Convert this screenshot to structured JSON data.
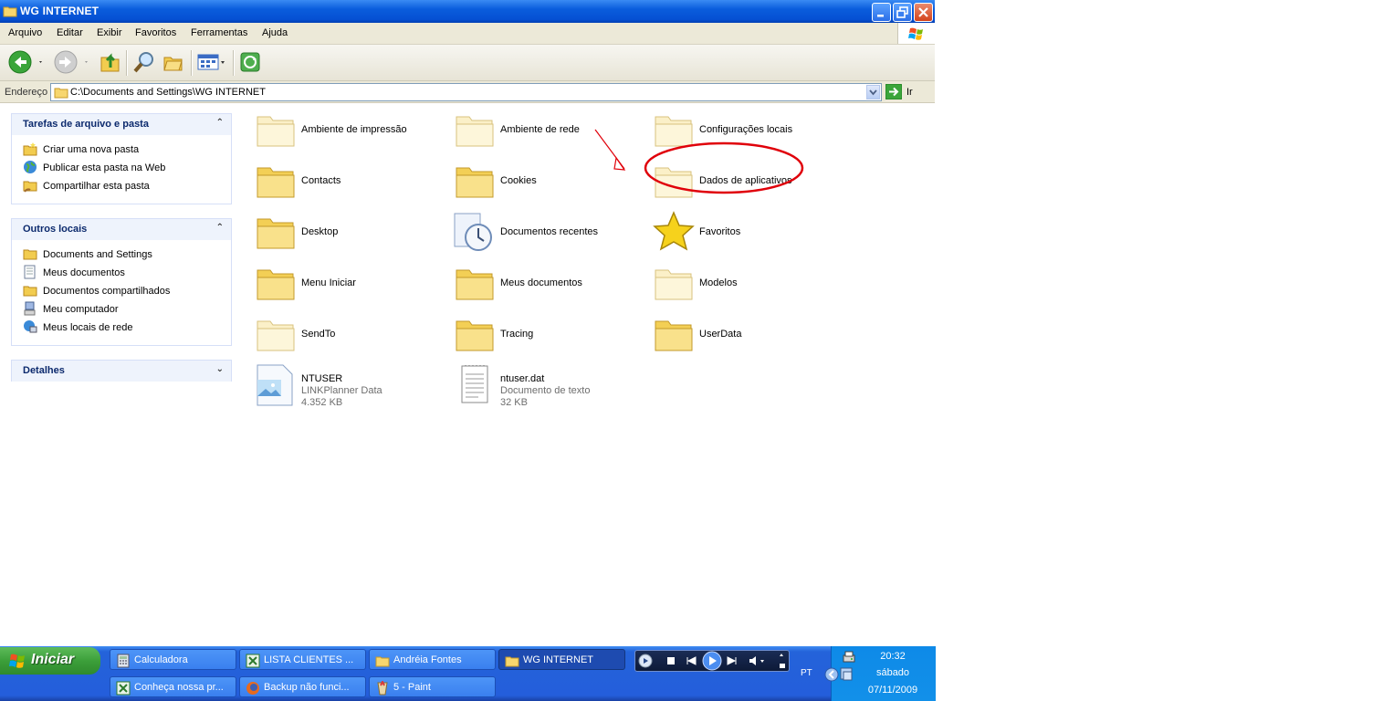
{
  "window": {
    "title": "WG INTERNET"
  },
  "menu": [
    "Arquivo",
    "Editar",
    "Exibir",
    "Favoritos",
    "Ferramentas",
    "Ajuda"
  ],
  "address": {
    "label": "Endereço",
    "path": "C:\\Documents and Settings\\WG INTERNET",
    "go_label": "Ir"
  },
  "tasks_panel": {
    "title": "Tarefas de arquivo e pasta",
    "items": [
      "Criar uma nova pasta",
      "Publicar esta pasta na Web",
      "Compartilhar esta pasta"
    ]
  },
  "places_panel": {
    "title": "Outros locais",
    "items": [
      "Documents and Settings",
      "Meus documentos",
      "Documentos compartilhados",
      "Meu computador",
      "Meus locais de rede"
    ]
  },
  "details_panel": {
    "title": "Detalhes"
  },
  "files": [
    {
      "name": "Ambiente de impressão",
      "icon": "folder-pale-icon"
    },
    {
      "name": "Ambiente de rede",
      "icon": "folder-pale-icon"
    },
    {
      "name": "Configurações locais",
      "icon": "folder-pale-icon"
    },
    {
      "name": "Contacts",
      "icon": "folder-icon"
    },
    {
      "name": "Cookies",
      "icon": "folder-icon"
    },
    {
      "name": "Dados de aplicativos",
      "icon": "folder-pale-icon"
    },
    {
      "name": "Desktop",
      "icon": "folder-icon"
    },
    {
      "name": "Documentos recentes",
      "icon": "recent-documents-icon"
    },
    {
      "name": "Favoritos",
      "icon": "star-icon"
    },
    {
      "name": "Menu Iniciar",
      "icon": "folder-icon"
    },
    {
      "name": "Meus documentos",
      "icon": "folder-icon"
    },
    {
      "name": "Modelos",
      "icon": "folder-pale-icon"
    },
    {
      "name": "SendTo",
      "icon": "folder-pale-icon"
    },
    {
      "name": "Tracing",
      "icon": "folder-icon"
    },
    {
      "name": "UserData",
      "icon": "folder-icon"
    },
    {
      "name": "NTUSER",
      "type": "LINKPlanner Data",
      "size": "4.352 KB",
      "icon": "image-file-icon"
    },
    {
      "name": "ntuser.dat",
      "type": "Documento de texto",
      "size": "32 KB",
      "icon": "text-file-icon"
    }
  ],
  "annotation": {
    "highlight_color": "#e0000a"
  },
  "taskbar": {
    "start_label": "Iniciar",
    "tasks": [
      {
        "label": "Calculadora",
        "icon": "calculator-icon",
        "active": false
      },
      {
        "label": "LISTA CLIENTES ...",
        "icon": "excel-icon",
        "active": false
      },
      {
        "label": "Andréia Fontes",
        "icon": "folder-icon",
        "active": false
      },
      {
        "label": "WG INTERNET",
        "icon": "folder-icon",
        "active": true
      },
      {
        "label": "Conheça nossa pr...",
        "icon": "excel-icon",
        "active": false
      },
      {
        "label": "Backup não funci...",
        "icon": "firefox-icon",
        "active": false
      },
      {
        "label": "5 - Paint",
        "icon": "paint-icon",
        "active": false
      }
    ],
    "language": "PT",
    "clock": {
      "time": "20:32",
      "day": "sábado",
      "date": "07/11/2009"
    }
  }
}
